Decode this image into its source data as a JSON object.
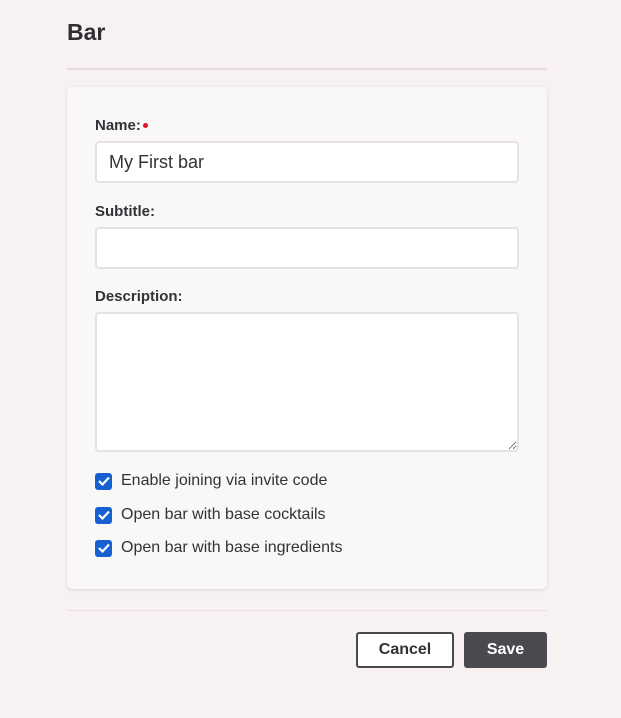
{
  "page": {
    "title": "Bar"
  },
  "form": {
    "name": {
      "label": "Name:",
      "value": "My First bar",
      "required": true
    },
    "subtitle": {
      "label": "Subtitle:",
      "value": ""
    },
    "description": {
      "label": "Description:",
      "value": ""
    },
    "options": [
      {
        "label": "Enable joining via invite code",
        "checked": true
      },
      {
        "label": "Open bar with base cocktails",
        "checked": true
      },
      {
        "label": "Open bar with base ingredients",
        "checked": true
      }
    ]
  },
  "actions": {
    "cancel_label": "Cancel",
    "save_label": "Save"
  },
  "colors": {
    "background": "#f7f1f2",
    "card": "#faf7f7",
    "checkbox": "#1660d2",
    "required_dot": "#e0142b",
    "primary_button": "#4a4950"
  }
}
